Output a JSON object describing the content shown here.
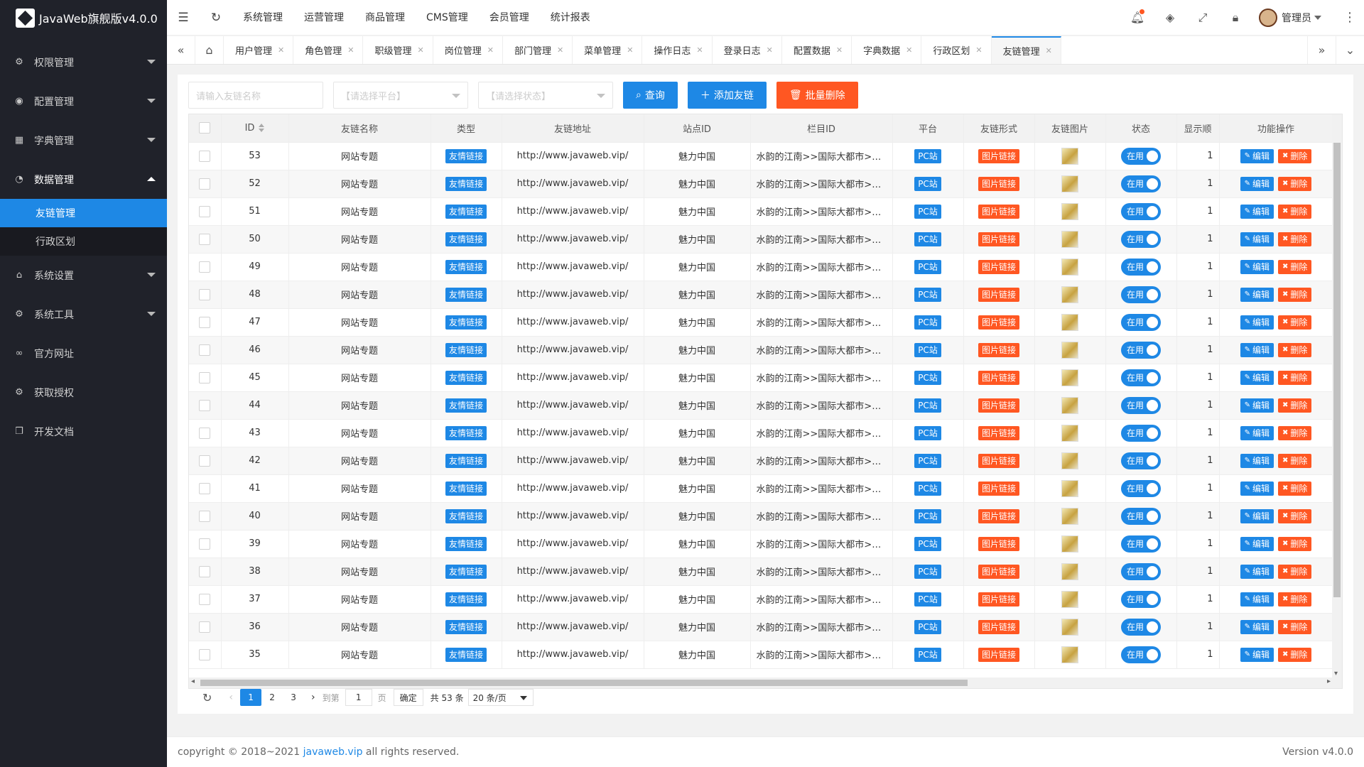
{
  "app": {
    "title": "JavaWeb旗舰版v4.0.0"
  },
  "sidebar": {
    "items": [
      {
        "label": "权限管理",
        "icon": "gear-icon",
        "glyph": "⚙",
        "arrow": "down"
      },
      {
        "label": "配置管理",
        "icon": "globe-icon",
        "glyph": "◉",
        "arrow": "down"
      },
      {
        "label": "字典管理",
        "icon": "app-grid-icon",
        "glyph": "▦",
        "arrow": "down"
      },
      {
        "label": "数据管理",
        "icon": "dashboard-icon",
        "glyph": "◔",
        "arrow": "up"
      }
    ],
    "subitems": [
      {
        "label": "友链管理",
        "active": true
      },
      {
        "label": "行政区划",
        "active": false
      }
    ],
    "items2": [
      {
        "label": "系统设置",
        "icon": "home-icon",
        "glyph": "⌂",
        "arrow": "down"
      },
      {
        "label": "系统工具",
        "icon": "gear-icon",
        "glyph": "⚙",
        "arrow": "down"
      },
      {
        "label": "官方网址",
        "icon": "link-icon",
        "glyph": "∞",
        "arrow": ""
      },
      {
        "label": "获取授权",
        "icon": "gear-icon",
        "glyph": "⚙",
        "arrow": ""
      },
      {
        "label": "开发文档",
        "icon": "book-icon",
        "glyph": "❒",
        "arrow": ""
      }
    ]
  },
  "header": {
    "nav": [
      "系统管理",
      "运营管理",
      "商品管理",
      "CMS管理",
      "会员管理",
      "统计报表"
    ],
    "user": "管理员"
  },
  "tabs": [
    "用户管理",
    "角色管理",
    "职级管理",
    "岗位管理",
    "部门管理",
    "菜单管理",
    "操作日志",
    "登录日志",
    "配置数据",
    "字典数据",
    "行政区划",
    "友链管理"
  ],
  "active_tab": "友链管理",
  "filters": {
    "name_placeholder": "请输入友链名称",
    "platform_placeholder": "【请选择平台】",
    "status_placeholder": "【请选择状态】",
    "search_label": "查询",
    "add_label": "添加友链",
    "batch_delete_label": "批量删除"
  },
  "table": {
    "columns": [
      "ID",
      "友链名称",
      "类型",
      "友链地址",
      "站点ID",
      "栏目ID",
      "平台",
      "友链形式",
      "友链图片",
      "状态",
      "显示顺",
      "功能操作"
    ],
    "rows": [
      {
        "id": "53"
      },
      {
        "id": "52"
      },
      {
        "id": "51"
      },
      {
        "id": "50"
      },
      {
        "id": "49"
      },
      {
        "id": "48"
      },
      {
        "id": "47"
      },
      {
        "id": "46"
      },
      {
        "id": "45"
      },
      {
        "id": "44"
      },
      {
        "id": "43"
      },
      {
        "id": "42"
      },
      {
        "id": "41"
      },
      {
        "id": "40"
      },
      {
        "id": "39"
      },
      {
        "id": "38"
      },
      {
        "id": "37"
      },
      {
        "id": "36"
      },
      {
        "id": "35"
      }
    ],
    "row_defaults": {
      "name": "网站专题",
      "type": "友情链接",
      "url": "http://www.javaweb.vip/",
      "site": "魅力中国",
      "column": "水韵的江南>>国际大都市>>中原...",
      "platform": "PC站",
      "form": "图片链接",
      "status": "在用",
      "order": "1",
      "edit": "编辑",
      "delete": "删除"
    }
  },
  "pager": {
    "pages": [
      "1",
      "2",
      "3"
    ],
    "current": "1",
    "goto_label": "到第",
    "goto_value": "1",
    "page_unit": "页",
    "ok_label": "确定",
    "total": "共 53 条",
    "size": "20 条/页"
  },
  "footer": {
    "copyright_prefix": "copyright © 2018~2021 ",
    "link": "javaweb.vip",
    "copyright_suffix": " all rights reserved.",
    "version": "Version v4.0.0"
  },
  "colors": {
    "primary": "#1e88e5",
    "danger": "#ff5722",
    "sidebar": "#20222a"
  }
}
